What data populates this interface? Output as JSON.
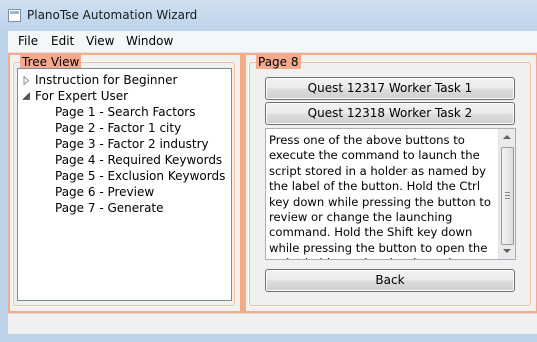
{
  "window": {
    "title": "PlanoTse Automation Wizard"
  },
  "menu": {
    "items": [
      {
        "label": "File"
      },
      {
        "label": "Edit"
      },
      {
        "label": "View"
      },
      {
        "label": "Window"
      }
    ]
  },
  "tree_panel": {
    "legend": "Tree View",
    "nodes": [
      {
        "label": "Instruction for Beginner",
        "expander": "collapsed"
      },
      {
        "label": "For Expert User",
        "expander": "expanded"
      }
    ],
    "children": [
      {
        "label": "Page 1 - Search Factors"
      },
      {
        "label": "Page 2 - Factor 1 city"
      },
      {
        "label": "Page 3 - Factor 2 industry"
      },
      {
        "label": "Page 4 - Required Keywords"
      },
      {
        "label": "Page 5 - Exclusion Keywords"
      },
      {
        "label": "Page 6 - Preview"
      },
      {
        "label": "Page 7 - Generate"
      }
    ]
  },
  "page_panel": {
    "legend": "Page 8",
    "buttons": [
      {
        "label": "Quest 12317 Worker Task 1"
      },
      {
        "label": "Quest 12318 Worker Task 2"
      }
    ],
    "description": "Press one of the above buttons to execute the command to launch the script stored in a holder as named by the label of the button. Hold the Ctrl key down while pressing the button to review or change the launching command. Hold the Shift key down while pressing the button to open the script holder and review its code.",
    "back_label": "Back"
  },
  "colors": {
    "panel_border": "#f7a98c",
    "window_frame": "#cfe0ef"
  }
}
